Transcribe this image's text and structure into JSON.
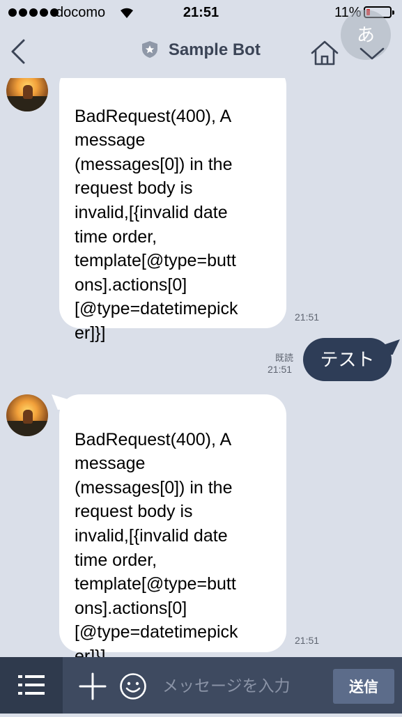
{
  "status_bar": {
    "carrier": "docomo",
    "time": "21:51",
    "battery_percent": "11%",
    "battery_level": 0.11,
    "battery_color": "#e02020",
    "ime_char": "あ"
  },
  "header": {
    "title": "Sample Bot",
    "back_icon": "chevron-left-icon",
    "home_icon": "home-icon",
    "menu_icon": "chevron-down-icon"
  },
  "messages": [
    {
      "sender": "bot",
      "text": "BadRequest(400), A\nmessage\n(messages[0]) in the\nrequest body is\ninvalid,[{invalid date\ntime order,\ntemplate[@type=butt\nons].actions[0]\n[@type=datetimepick\ner]}]",
      "time": "21:51"
    },
    {
      "sender": "me",
      "text": "テスト",
      "read": "既読",
      "time": "21:51"
    },
    {
      "sender": "bot",
      "text": "BadRequest(400), A\nmessage\n(messages[0]) in the\nrequest body is\ninvalid,[{invalid date\ntime order,\ntemplate[@type=butt\nons].actions[0]\n[@type=datetimepick\ner]}]",
      "time": "21:51"
    }
  ],
  "input_bar": {
    "placeholder": "メッセージを入力",
    "send_label": "送信"
  },
  "colors": {
    "background": "#dadfe9",
    "my_bubble": "#2e3d57",
    "bottom_bar": "#3e4a60",
    "send_button": "#5c6c8a"
  }
}
